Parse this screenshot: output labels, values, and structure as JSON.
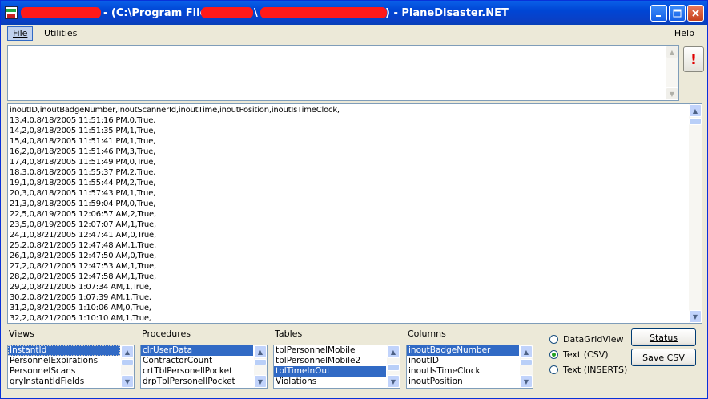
{
  "titlebar": {
    "prefix": "- (C:\\Program Files\\",
    "separator": "\\",
    "suffix": ") - PlaneDisaster.NET",
    "minimize_icon": "minimize-icon",
    "maximize_icon": "maximize-icon",
    "close_icon": "close-icon"
  },
  "menu": {
    "file": "File",
    "utilities": "Utilities",
    "help": "Help"
  },
  "error_button": {
    "label": "!",
    "color": "#E00000"
  },
  "output": {
    "lines": [
      "inoutID,inoutBadgeNumber,inoutScannerId,inoutTime,inoutPosition,inoutIsTimeClock,",
      "13,4,0,8/18/2005 11:51:16 PM,0,True,",
      "14,2,0,8/18/2005 11:51:35 PM,1,True,",
      "15,4,0,8/18/2005 11:51:41 PM,1,True,",
      "16,2,0,8/18/2005 11:51:46 PM,3,True,",
      "17,4,0,8/18/2005 11:51:49 PM,0,True,",
      "18,3,0,8/18/2005 11:55:37 PM,2,True,",
      "19,1,0,8/18/2005 11:55:44 PM,2,True,",
      "20,3,0,8/18/2005 11:57:43 PM,1,True,",
      "21,3,0,8/18/2005 11:59:04 PM,0,True,",
      "22,5,0,8/19/2005 12:06:57 AM,2,True,",
      "23,5,0,8/19/2005 12:07:07 AM,1,True,",
      "24,1,0,8/21/2005 12:47:41 AM,0,True,",
      "25,2,0,8/21/2005 12:47:48 AM,1,True,",
      "26,1,0,8/21/2005 12:47:50 AM,0,True,",
      "27,2,0,8/21/2005 12:47:53 AM,1,True,",
      "28,2,0,8/21/2005 12:47:58 AM,1,True,",
      "29,2,0,8/21/2005 1:07:34 AM,1,True,",
      "30,2,0,8/21/2005 1:07:39 AM,1,True,",
      "31,2,0,8/21/2005 1:10:06 AM,0,True,",
      "32,2,0,8/21/2005 1:10:10 AM,1,True,"
    ]
  },
  "views": {
    "label": "Views",
    "items": [
      "InstantId",
      "PersonnelExpirations",
      "PersonnelScans",
      "qryInstantIdFields"
    ]
  },
  "procedures": {
    "label": "Procedures",
    "items": [
      "clrUserData",
      "ContractorCount",
      "crtTblPersonellPocket",
      "drpTblPersonellPocket"
    ]
  },
  "tables": {
    "label": "Tables",
    "items": [
      "tblPersonnelMobile",
      "tblPersonnelMobile2",
      "tblTimeInOut",
      "Violations"
    ]
  },
  "columns": {
    "label": "Columns",
    "items": [
      "inoutBadgeNumber",
      "inoutID",
      "inoutIsTimeClock",
      "inoutPosition"
    ]
  },
  "format_options": [
    {
      "label": "DataGridView",
      "checked": false
    },
    {
      "label": "Text (CSV)",
      "checked": true
    },
    {
      "label": "Text (INSERTS)",
      "checked": false
    }
  ],
  "buttons": {
    "status": "Status",
    "save_csv": "Save CSV"
  },
  "colors": {
    "selection": "#316AC5",
    "titlebar": "#0046D5",
    "redaction": "#FF1A1A"
  }
}
